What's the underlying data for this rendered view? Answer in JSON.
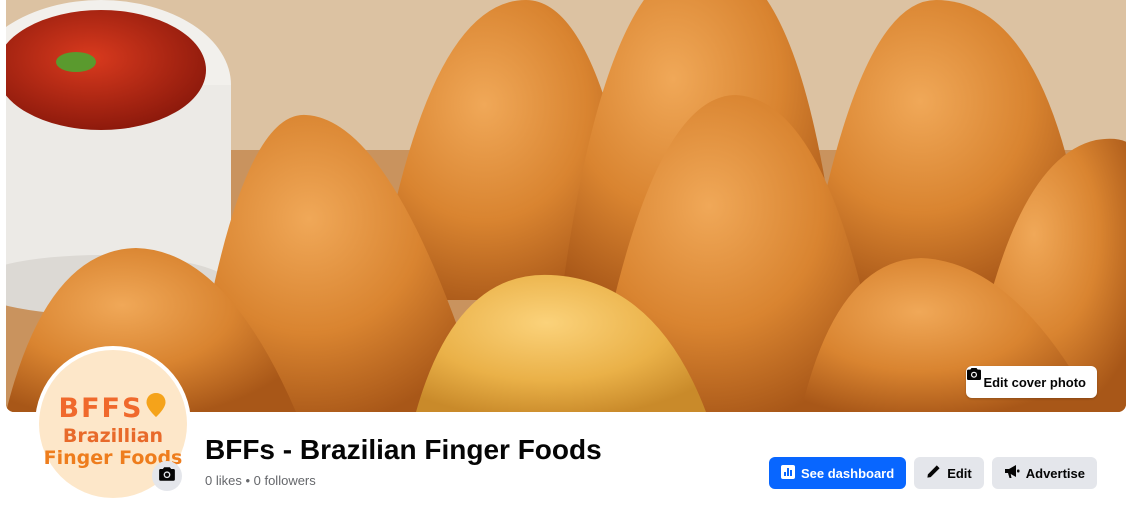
{
  "cover": {
    "edit_button_label": "Edit cover photo",
    "edit_icon": "camera-icon"
  },
  "profile": {
    "logo": {
      "letters": "BFFS",
      "line1": "Brazillian",
      "line2": "Finger Foods",
      "pin_icon": "map-pin-icon"
    },
    "avatar_edit_icon": "camera-icon",
    "title": "BFFs - Brazilian Finger Foods",
    "stats": "0 likes • 0 followers"
  },
  "actions": {
    "dashboard_label": "See dashboard",
    "dashboard_icon": "bar-chart-icon",
    "edit_label": "Edit",
    "edit_icon": "pencil-icon",
    "advertise_label": "Advertise",
    "advertise_icon": "megaphone-icon"
  },
  "colors": {
    "primary": "#0866ff",
    "secondary_bg": "#e4e6eb",
    "logo_orange": "#f0692c"
  }
}
